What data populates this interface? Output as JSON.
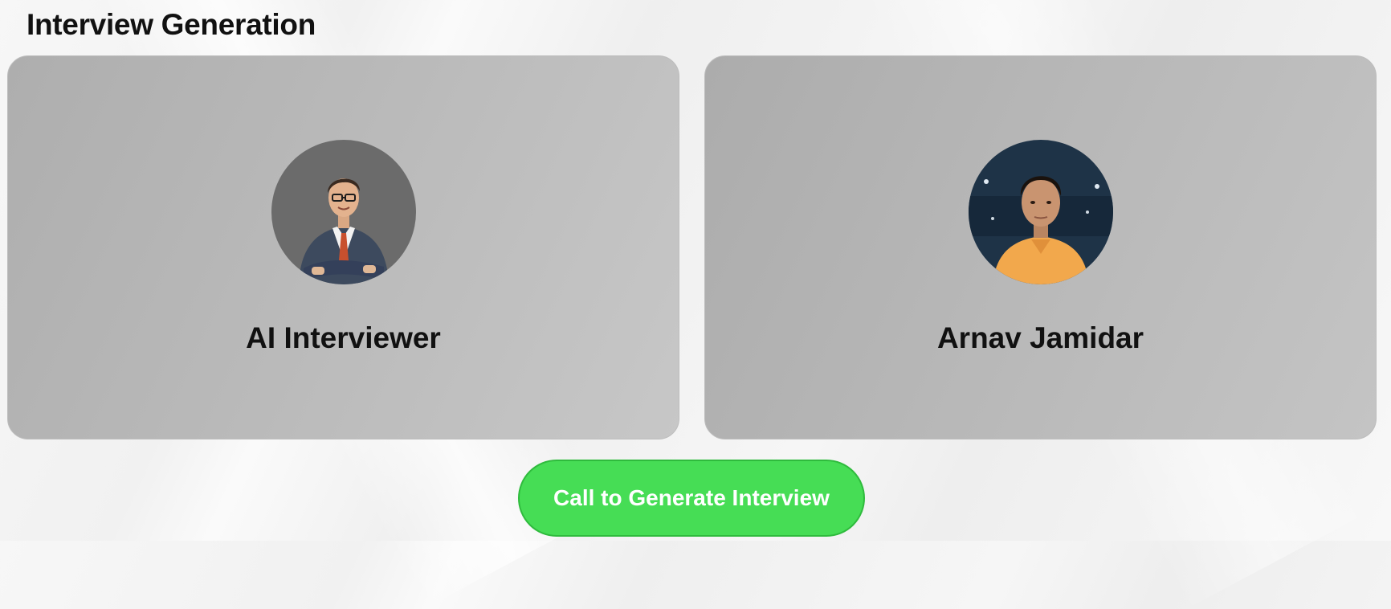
{
  "header": {
    "title": "Interview Generation"
  },
  "cards": [
    {
      "name": "AI Interviewer",
      "avatar": "ai-interviewer-portrait"
    },
    {
      "name": "Arnav Jamidar",
      "avatar": "user-portrait"
    }
  ],
  "actions": {
    "generate_label": "Call to Generate Interview"
  },
  "colors": {
    "accent_green": "#46dd55",
    "card_gray": "#b9b9b9",
    "text_dark": "#111111"
  }
}
